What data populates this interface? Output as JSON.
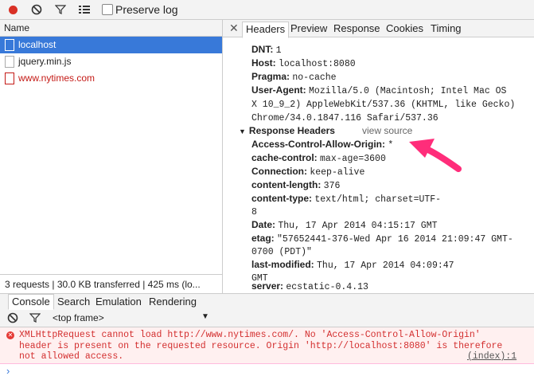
{
  "toolbar": {
    "preserve_log_label": "Preserve log"
  },
  "left_panel": {
    "header": "Name",
    "requests": [
      {
        "label": "localhost"
      },
      {
        "label": "jquery.min.js"
      },
      {
        "label": "www.nytimes.com"
      }
    ],
    "status": "3 requests | 30.0 KB transferred | 425 ms (lo..."
  },
  "right_panel": {
    "tabs": [
      "Headers",
      "Preview",
      "Response",
      "Cookies",
      "Timing"
    ],
    "request_headers": [
      {
        "key": "DNT:",
        "value": "1"
      },
      {
        "key": "Host:",
        "value": "localhost:8080"
      },
      {
        "key": "Pragma:",
        "value": "no-cache"
      },
      {
        "key": "User-Agent:",
        "value": "Mozilla/5.0 (Macintosh; Intel Mac OS"
      },
      {
        "key": "",
        "value": "X 10_9_2) AppleWebKit/537.36 (KHTML, like Gecko)"
      },
      {
        "key": "",
        "value": "Chrome/34.0.1847.116 Safari/537.36"
      }
    ],
    "response_section": "Response Headers",
    "view_source": "view source",
    "response_headers": [
      {
        "key": "Access-Control-Allow-Origin:",
        "value": "*"
      },
      {
        "key": "cache-control:",
        "value": "max-age=3600"
      },
      {
        "key": "Connection:",
        "value": "keep-alive"
      },
      {
        "key": "content-length:",
        "value": "376"
      },
      {
        "key": "content-type:",
        "value": "text/html; charset=UTF-"
      },
      {
        "key": "",
        "value": "8"
      },
      {
        "key": "Date:",
        "value": "Thu, 17 Apr 2014 04:15:17 GMT"
      },
      {
        "key": "etag:",
        "value": "\"57652441-376-Wed Apr 16 2014 21:09:47 GMT-"
      },
      {
        "key": "",
        "value": "0700 (PDT)\""
      },
      {
        "key": "last-modified:",
        "value": "Thu, 17 Apr 2014 04:09:47"
      },
      {
        "key": "",
        "value": "GMT"
      },
      {
        "key": "server:",
        "value": "ecstatic-0.4.13"
      }
    ]
  },
  "console": {
    "tabs": [
      "Console",
      "Search",
      "Emulation",
      "Rendering"
    ],
    "frame": "<top frame>",
    "error_lines": [
      "XMLHttpRequest cannot load http://www.nytimes.com/. No 'Access-Control-Allow-Origin'",
      "header is present on the requested resource. Origin 'http://localhost:8080' is therefore",
      "not allowed access."
    ],
    "error_source": "(index):1",
    "prompt": "›"
  },
  "colors": {
    "selected_row": "#3879d9",
    "error_text": "#d32f2f",
    "annotation_arrow": "#ff2d7a"
  }
}
